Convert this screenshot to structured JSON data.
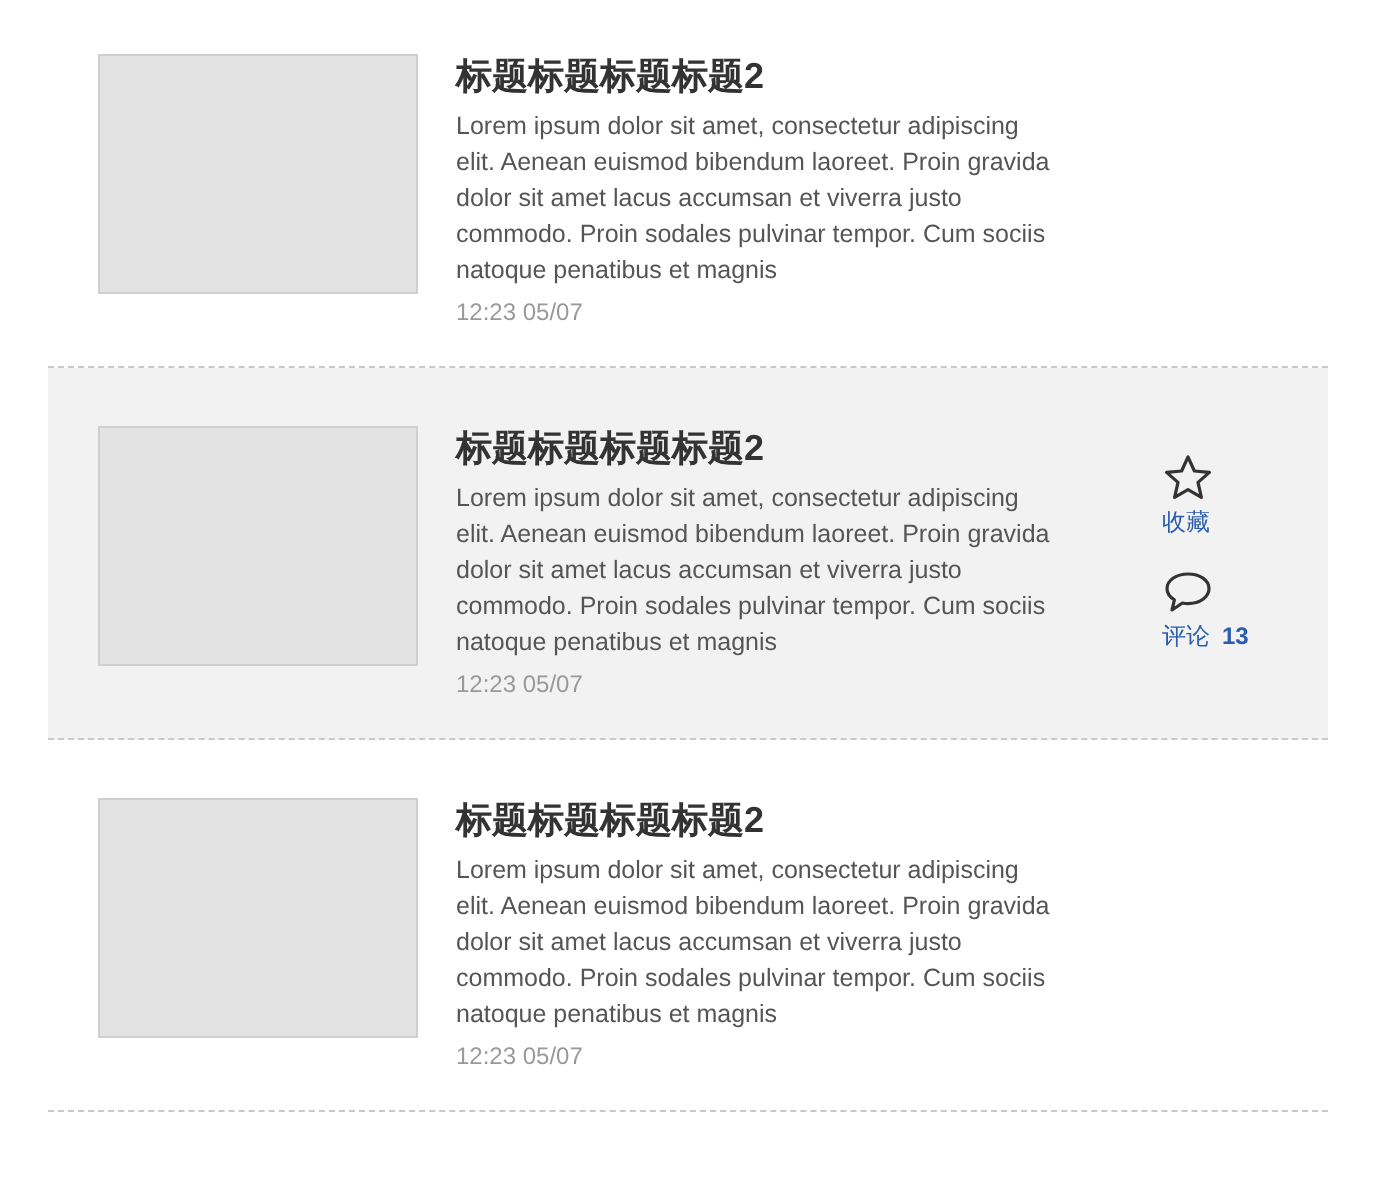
{
  "articles": [
    {
      "title": "标题标题标题标题2",
      "summary": "Lorem ipsum dolor sit amet, consectetur adipiscing elit. Aenean euismod bibendum laoreet. Proin gravida dolor sit amet lacus accumsan et viverra justo commodo. Proin sodales pulvinar tempor. Cum sociis natoque penatibus et magnis",
      "time": "12:23 05/07",
      "highlighted": false
    },
    {
      "title": "标题标题标题标题2",
      "summary": "Lorem ipsum dolor sit amet, consectetur adipiscing elit. Aenean euismod bibendum laoreet. Proin gravida dolor sit amet lacus accumsan et viverra justo commodo. Proin sodales pulvinar tempor. Cum sociis natoque penatibus et magnis",
      "time": "12:23 05/07",
      "highlighted": true,
      "actions": [
        {
          "kind": "favorite",
          "label": "收藏"
        },
        {
          "kind": "comment",
          "label": "评论",
          "count": "13"
        }
      ]
    },
    {
      "title": "标题标题标题标题2",
      "summary": "Lorem ipsum dolor sit amet, consectetur adipiscing elit. Aenean euismod bibendum laoreet. Proin gravida dolor sit amet lacus accumsan et viverra justo commodo. Proin sodales pulvinar tempor. Cum sociis natoque penatibus et magnis",
      "time": "12:23 05/07",
      "highlighted": false
    }
  ]
}
